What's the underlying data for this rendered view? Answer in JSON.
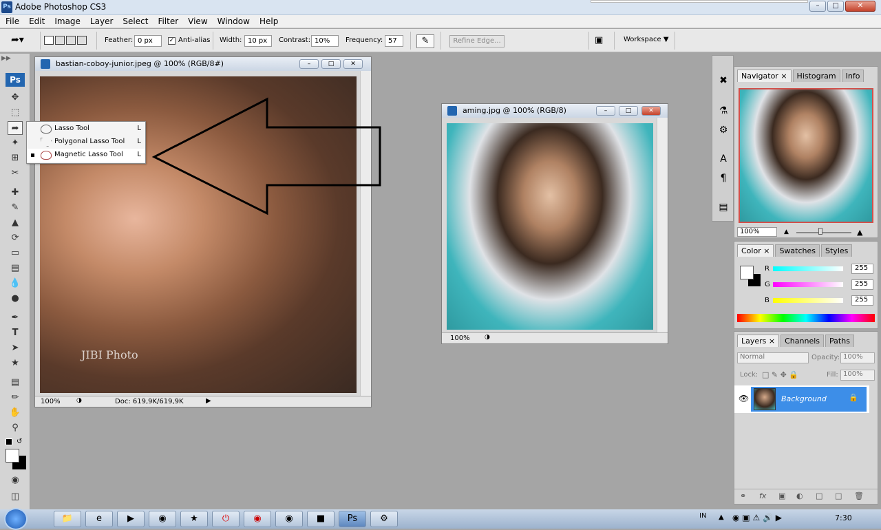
{
  "app": {
    "title": "Adobe Photoshop CS3",
    "icon_label": "Ps"
  },
  "menu": [
    "File",
    "Edit",
    "Image",
    "Layer",
    "Select",
    "Filter",
    "View",
    "Window",
    "Help"
  ],
  "options": {
    "feather_label": "Feather:",
    "feather_value": "0 px",
    "antialias_label": "Anti-alias",
    "width_label": "Width:",
    "width_value": "10 px",
    "contrast_label": "Contrast:",
    "contrast_value": "10%",
    "frequency_label": "Frequency:",
    "frequency_value": "57",
    "refine_edge": "Refine Edge...",
    "workspace": "Workspace"
  },
  "toolbox": {
    "ps_badge": "Ps"
  },
  "flyout": [
    {
      "label": "Lasso Tool",
      "key": "L"
    },
    {
      "label": "Polygonal Lasso Tool",
      "key": "L"
    },
    {
      "label": "Magnetic Lasso Tool",
      "key": "L"
    }
  ],
  "doc1": {
    "title": "bastian-coboy-junior.jpeg @ 100% (RGB/8#)",
    "zoom": "100%",
    "doc_info": "Doc: 619,9K/619,9K",
    "watermark": "JIBI Photo"
  },
  "doc2": {
    "title": "aming.jpg @ 100% (RGB/8)",
    "zoom": "100%"
  },
  "navigator": {
    "tabs": [
      "Navigator",
      "Histogram",
      "Info"
    ],
    "zoom": "100%"
  },
  "color": {
    "tabs": [
      "Color",
      "Swatches",
      "Styles"
    ],
    "r_label": "R",
    "g_label": "G",
    "b_label": "B",
    "r": "255",
    "g": "255",
    "b": "255"
  },
  "layers": {
    "tabs": [
      "Layers",
      "Channels",
      "Paths"
    ],
    "blend_mode": "Normal",
    "opacity_label": "Opacity:",
    "opacity": "100%",
    "lock_label": "Lock:",
    "fill_label": "Fill:",
    "fill": "100%",
    "layer_name": "Background"
  },
  "taskbar": {
    "lang": "IN",
    "time": "7:30"
  }
}
